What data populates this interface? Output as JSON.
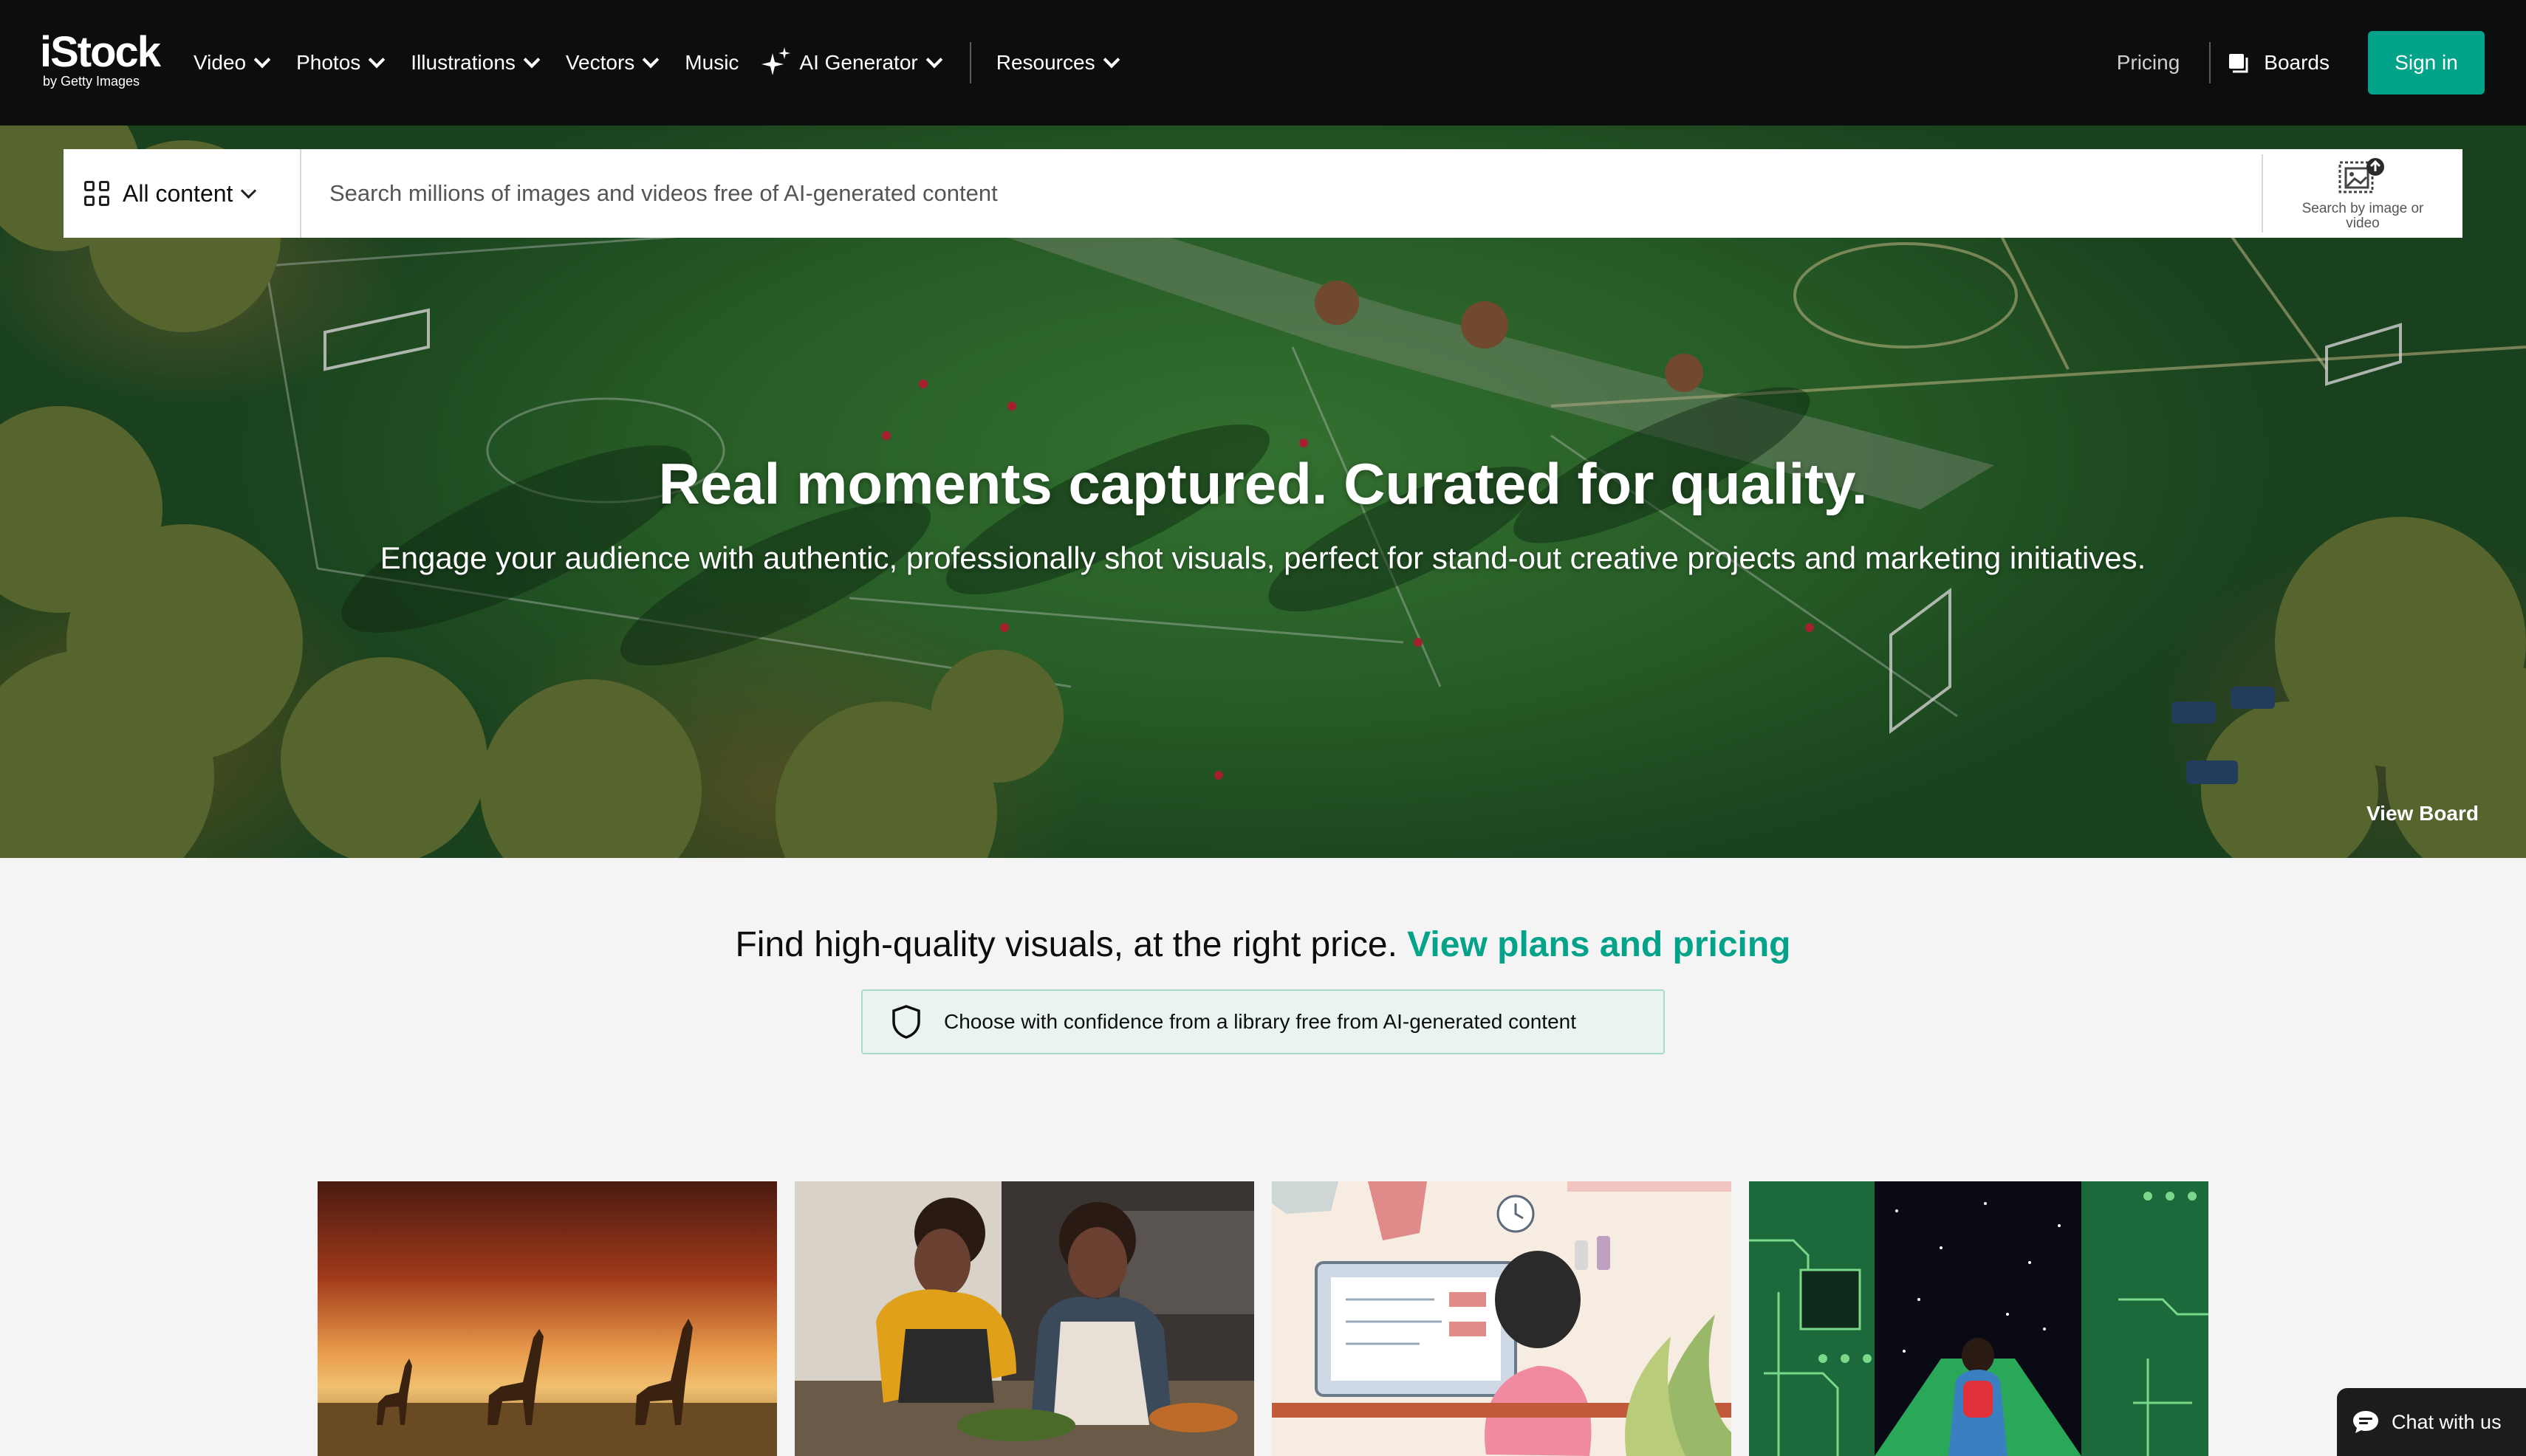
{
  "brand": {
    "name": "iStock",
    "sub": "by Getty Images"
  },
  "nav": {
    "items": [
      {
        "label": "Video"
      },
      {
        "label": "Photos"
      },
      {
        "label": "Illustrations"
      },
      {
        "label": "Vectors"
      },
      {
        "label": "Music"
      },
      {
        "label": "AI Generator"
      },
      {
        "label": "Resources"
      }
    ],
    "pricing": "Pricing",
    "boards": "Boards",
    "signin": "Sign in"
  },
  "search": {
    "scope": "All content",
    "placeholder": "Search millions of images and videos free of AI-generated content",
    "visual_search_label": "Search by image or video"
  },
  "hero": {
    "headline": "Real moments captured. Curated for quality.",
    "subheadline": "Engage your audience with authentic, professionally shot visuals, perfect for stand-out creative projects and marketing initiatives.",
    "view_board": "View Board"
  },
  "plans": {
    "text": "Find high-quality visuals, at the right price.",
    "link": "View plans and pricing",
    "badge": "Choose with confidence from a library free from AI-generated content"
  },
  "thumbnails": [
    {
      "icon": "giraffes-sunset-image"
    },
    {
      "icon": "women-cooking-image"
    },
    {
      "icon": "woman-at-desk-illustration"
    },
    {
      "icon": "circuit-portal-illustration"
    }
  ],
  "chat": {
    "label": "Chat with us"
  },
  "colors": {
    "accent": "#02a388",
    "nav_bg": "#0c0d0d",
    "page_bg": "#f4f4f4"
  }
}
